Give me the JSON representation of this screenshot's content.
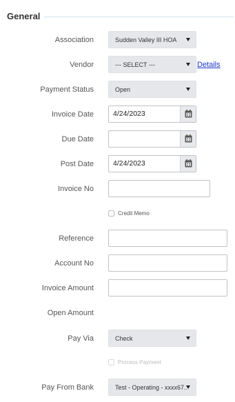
{
  "section": {
    "title": "General"
  },
  "fields": {
    "association": {
      "label": "Association",
      "value": "Sudden Valley III HOA"
    },
    "vendor": {
      "label": "Vendor",
      "value": "--- SELECT ---",
      "link": "Details"
    },
    "payment_status": {
      "label": "Payment Status",
      "value": "Open"
    },
    "invoice_date": {
      "label": "Invoice Date",
      "value": "4/24/2023"
    },
    "due_date": {
      "label": "Due Date",
      "value": ""
    },
    "post_date": {
      "label": "Post Date",
      "value": "4/24/2023"
    },
    "invoice_no": {
      "label": "Invoice No",
      "value": ""
    },
    "credit_memo": {
      "label": "Credit Memo",
      "checked": false
    },
    "reference": {
      "label": "Reference",
      "value": ""
    },
    "account_no": {
      "label": "Account No",
      "value": ""
    },
    "invoice_amount": {
      "label": "Invoice Amount",
      "value": ""
    },
    "open_amount": {
      "label": "Open Amount",
      "value": ""
    },
    "pay_via": {
      "label": "Pay Via",
      "value": "Check"
    },
    "process_payment": {
      "label": "Process Payment",
      "checked": false,
      "disabled": true
    },
    "pay_from_bank": {
      "label": "Pay From Bank",
      "value": "Test - Operating - xxxx67..."
    }
  },
  "icons": {
    "calendar": "calendar-icon",
    "dropdown": "chevron-down-icon"
  },
  "colors": {
    "link": "#1a35c9",
    "select_bg": "#e6e7ea",
    "section_line": "#cfe3ee"
  }
}
